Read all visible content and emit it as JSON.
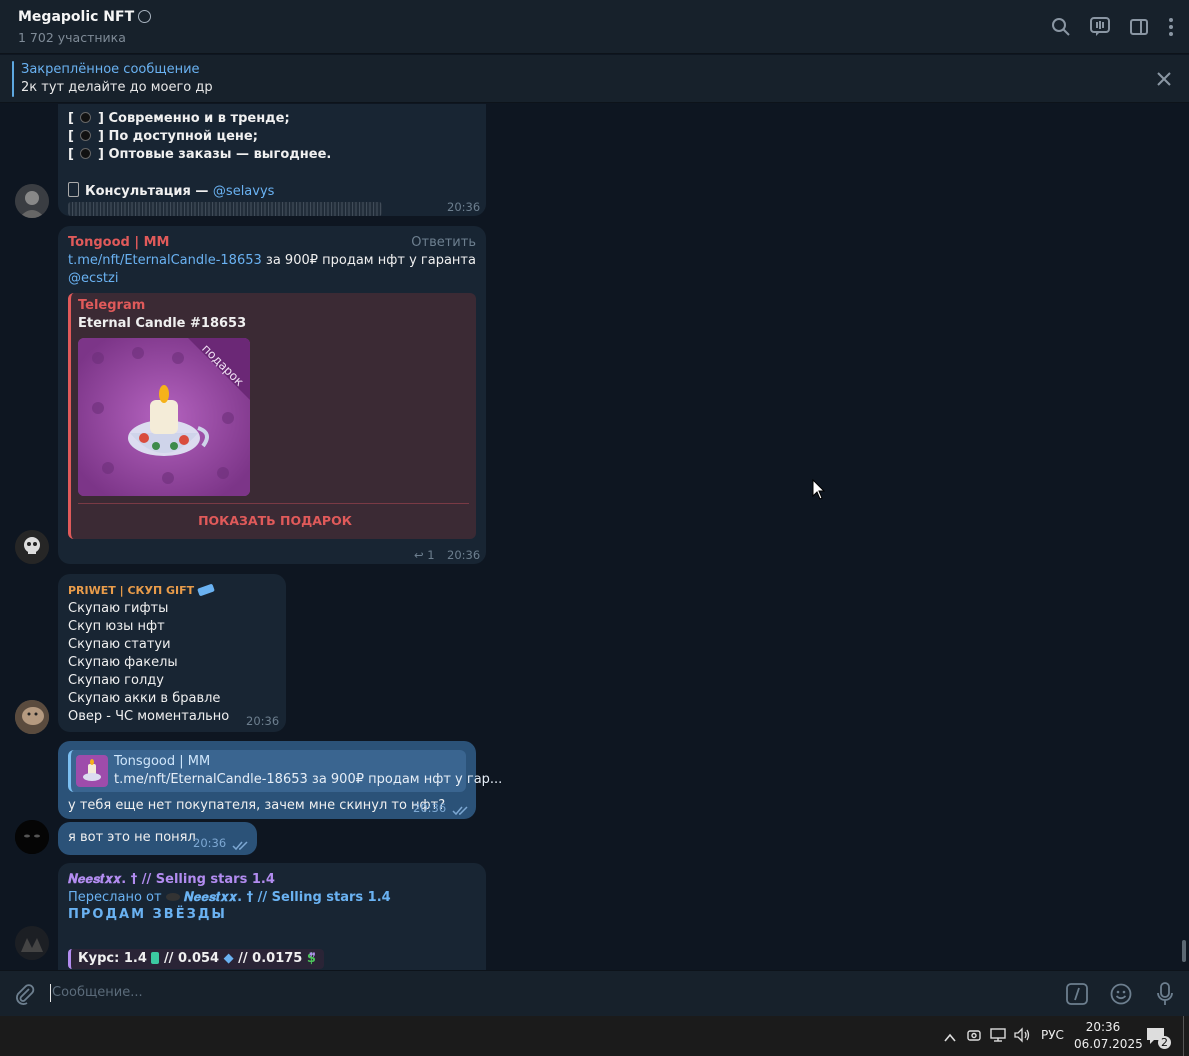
{
  "header": {
    "title": "Megapolic NFT",
    "members": "1 702 участника",
    "icons": [
      "search-icon",
      "live-stream-icon",
      "sidebar-toggle-icon",
      "more-vertical-icon"
    ]
  },
  "pinned": {
    "label": "Закреплённое сообщение",
    "text": "2к тут делайте до моего др"
  },
  "messages": {
    "m1": {
      "lines": [
        "Современно и в тренде;",
        "По доступной цене;",
        "Оптовые заказы — выгоднее."
      ],
      "consult_label": "Консультация —",
      "consult_link": "@selavys",
      "time": "20:36"
    },
    "m2": {
      "sender": "Tongood | MM",
      "reply_action": "Ответить",
      "link": "t.me/nft/EternalCandle-18653",
      "text": "за 900₽ продам нфт у гаранта",
      "mention": "@ecstzi",
      "preview_site": "Telegram",
      "preview_title": "Eternal Candle #18653",
      "gift_ribbon": "подарок",
      "button": "ПОКАЗАТЬ ПОДАРОК",
      "reply_count": "1",
      "time": "20:36"
    },
    "m3": {
      "sender": "PRIWET | СКУП GIFT",
      "lines": [
        "Скупаю гифты",
        "Скуп юзы нфт",
        "Скупаю статуи",
        "Скупаю факелы",
        "Скупаю голду",
        "Скупаю акки в бравле",
        "Овер - ЧС моментально"
      ],
      "time": "20:36"
    },
    "m4": {
      "reply_sender": "Tonsgood | MM",
      "reply_text": "t.me/nft/EternalCandle-18653 за 900₽ продам нфт у гар...",
      "text": "у тебя еще нет покупателя, зачем мне скинул то нфт?",
      "time": "20:36"
    },
    "m5": {
      "text": "я вот это не понял",
      "time": "20:36"
    },
    "m6": {
      "sender": "𝑵𝒆𝒆𝒔𝒕𝒙𝒙. † // Selling stars 1.4",
      "forwarded_label": "Переслано от",
      "forwarded_from": "𝑵𝒆𝒆𝒔𝒕𝒙𝒙. † // Selling stars 1.4",
      "banner": "ПРОДАМ ЗВЁЗДЫ",
      "rate": "Курс: 1.4",
      "rate2": "// 0.054",
      "rate3": "// 0.0175"
    }
  },
  "input": {
    "placeholder": "Сообщение..."
  },
  "taskbar": {
    "lang": "РУС",
    "time": "20:36",
    "date": "06.07.2025",
    "notifications": "2"
  }
}
